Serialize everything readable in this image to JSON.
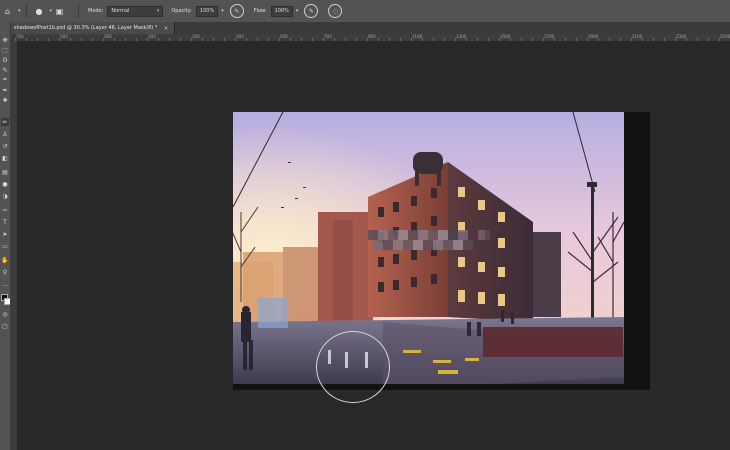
{
  "options_bar": {
    "mode_label": "Mode:",
    "mode_value": "Normal",
    "opacity_label": "Opacity:",
    "opacity_value": "100%",
    "flow_label": "Flow:",
    "flow_value": "100%"
  },
  "document_tab": {
    "title": "shadowofPost1b.psd @ 30.3% (Layer 46, Layer Mask/8) *"
  },
  "ruler": {
    "top_labels": [
      "700",
      "650",
      "600",
      "550",
      "500",
      "450",
      "400",
      "350",
      "300",
      "250",
      "200",
      "150",
      "100",
      "50",
      "0",
      "50",
      "100",
      "150",
      "200",
      "250",
      "300",
      "350",
      "400",
      "450",
      "500",
      "550",
      "600",
      "650",
      "700",
      "750",
      "800",
      "850",
      "900",
      "950",
      "1000",
      "1050",
      "1100",
      "1150",
      "1200",
      "1250",
      "1300",
      "1350",
      "1400",
      "1450",
      "1500",
      "1550",
      "1600",
      "1650",
      "1700",
      "1750",
      "1800",
      "1850",
      "1900",
      "1950",
      "2000",
      "2050",
      "2100",
      "2150",
      "2200",
      "2250",
      "2300",
      "2350",
      "2400",
      "2450",
      "2500",
      "2550",
      "2600",
      "2650",
      "2700",
      "2750",
      "2800"
    ]
  },
  "icons": {
    "brush_tool": "brush-icon",
    "airbrush": "airbrush-icon",
    "pressure_opacity": "pressure-icon",
    "pressure_size": "pressure-size-icon"
  },
  "colors": {
    "ui_panel": "#535353",
    "workspace": "#282828",
    "foreground_swatch": "#111111",
    "background_swatch": "#ffffff"
  }
}
